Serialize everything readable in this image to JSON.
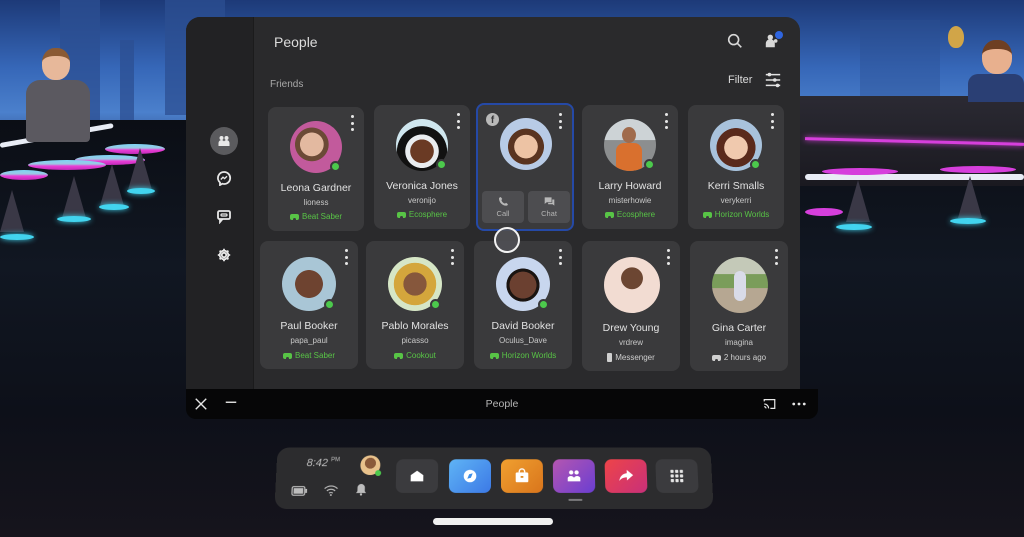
{
  "panel": {
    "title": "People",
    "section_label": "Friends",
    "filter_label": "Filter",
    "icons": {
      "search": "search-icon",
      "people_requests": "people-notification-icon",
      "filter": "sliders-icon"
    }
  },
  "left_rail": {
    "items": [
      {
        "name": "people",
        "icon": "people-icon",
        "active": true
      },
      {
        "name": "messenger",
        "icon": "messenger-icon",
        "active": false
      },
      {
        "name": "chats",
        "icon": "chat-bubble-icon",
        "active": false
      },
      {
        "name": "settings",
        "icon": "gear-icon",
        "active": false
      }
    ]
  },
  "friends": [
    {
      "name": "Leona Gardner",
      "handle": "lioness",
      "status": "Beat Saber",
      "status_type": "vr-app",
      "online": true
    },
    {
      "name": "Veronica Jones",
      "handle": "veronijo",
      "status": "Ecosphere",
      "status_type": "vr-app",
      "online": true
    },
    {
      "name": "",
      "handle": "",
      "status": "",
      "status_type": "selected",
      "online": false,
      "source_badge": "f",
      "actions": [
        {
          "label": "Call",
          "icon": "phone-icon"
        },
        {
          "label": "Chat",
          "icon": "chat-icon"
        }
      ]
    },
    {
      "name": "Larry Howard",
      "handle": "misterhowie",
      "status": "Ecosphere",
      "status_type": "vr-app",
      "online": true
    },
    {
      "name": "Kerri Smalls",
      "handle": "verykerri",
      "status": "Horizon Worlds",
      "status_type": "vr-app",
      "online": true
    },
    {
      "name": "Paul Booker",
      "handle": "papa_paul",
      "status": "Beat Saber",
      "status_type": "vr-app",
      "online": true
    },
    {
      "name": "Pablo Morales",
      "handle": "picasso",
      "status": "Cookout",
      "status_type": "vr-app",
      "online": true
    },
    {
      "name": "David Booker",
      "handle": "Oculus_Dave",
      "status": "Horizon Worlds",
      "status_type": "vr-app",
      "online": true
    },
    {
      "name": "Drew Young",
      "handle": "vrdrew",
      "status": "Messenger",
      "status_type": "phone",
      "online": false
    },
    {
      "name": "Gina Carter",
      "handle": "imagina",
      "status": "2 hours ago",
      "status_type": "last-seen",
      "online": false
    }
  ],
  "window_bar": {
    "title": "People",
    "icons": [
      "close-icon",
      "minimize-icon",
      "cast-icon",
      "more-icon"
    ]
  },
  "dock": {
    "time": "8:42",
    "ampm": "PM",
    "tray": [
      "battery-icon",
      "wifi-icon",
      "bell-icon"
    ],
    "apps": [
      {
        "name": "home",
        "icon": "home-icon",
        "color": "#3b3b3e"
      },
      {
        "name": "explore",
        "icon": "compass-icon",
        "color": "#3d8ee8"
      },
      {
        "name": "store",
        "icon": "shopping-bag-icon",
        "color": "#e08a22"
      },
      {
        "name": "people",
        "icon": "people-icon",
        "color": "#8a4dc8",
        "active": true
      },
      {
        "name": "share",
        "icon": "share-arrow-icon",
        "color": "#e0385a"
      },
      {
        "name": "app-library",
        "icon": "grid-icon",
        "color": "#3b3b3e"
      }
    ]
  },
  "colors": {
    "online": "#4cc94c",
    "status_green": "#58c446",
    "selection_border": "#2549a6",
    "notification_dot": "#2f65e0"
  }
}
